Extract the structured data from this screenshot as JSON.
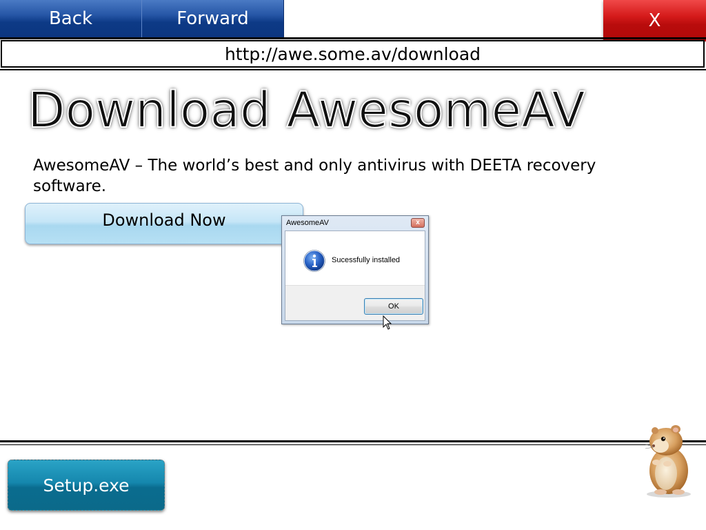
{
  "nav": {
    "back_label": "Back",
    "forward_label": "Forward",
    "close_label": "X"
  },
  "address_bar": {
    "url": "http://awe.some.av/download"
  },
  "page": {
    "heading": "Download AwesomeAV",
    "description": "AwesomeAV – The world’s best and only antivirus with DEETA recovery software.",
    "download_button_label": "Download Now"
  },
  "dialog": {
    "title": "AwesomeAV",
    "close_glyph": "x",
    "message": "Sucessfully installed",
    "ok_label": "OK",
    "icon": "info-icon"
  },
  "footer": {
    "setup_button_label": "Setup.exe"
  },
  "colors": {
    "nav_blue": "#0d3a86",
    "close_red": "#c40f0f",
    "download_button_blue": "#b6e0f4",
    "setup_button_teal": "#1587ad"
  }
}
